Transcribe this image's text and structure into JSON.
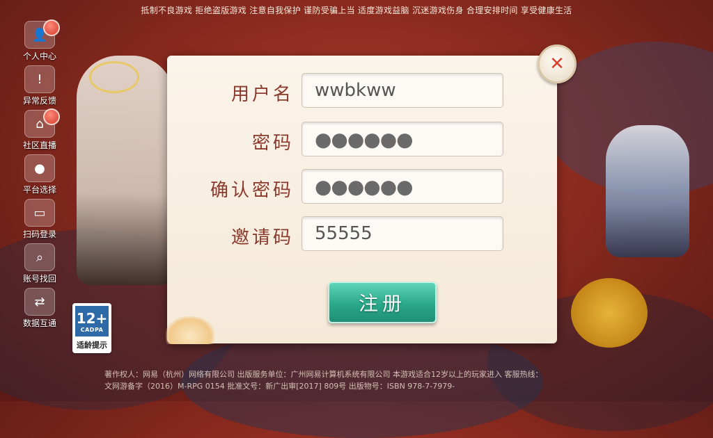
{
  "top_notice": "抵制不良游戏 拒绝盗版游戏 注意自我保护 谨防受骗上当 适度游戏益脑 沉迷游戏伤身 合理安排时间 享受健康生活",
  "sidebar": {
    "items": [
      {
        "label": "个人中心",
        "icon": "person-icon",
        "glyph": "👤",
        "badge": true
      },
      {
        "label": "异常反馈",
        "icon": "feedback-icon",
        "glyph": "!",
        "badge": false
      },
      {
        "label": "社区直播",
        "icon": "home-icon",
        "glyph": "⌂",
        "badge": true
      },
      {
        "label": "平台选择",
        "icon": "apple-icon",
        "glyph": "●",
        "badge": false
      },
      {
        "label": "扫码登录",
        "icon": "scan-icon",
        "glyph": "▭",
        "badge": false
      },
      {
        "label": "账号找回",
        "icon": "search-account-icon",
        "glyph": "⌕",
        "badge": false
      },
      {
        "label": "数据互通",
        "icon": "sync-icon",
        "glyph": "⇄",
        "badge": false
      }
    ]
  },
  "age_badge": {
    "rating": "12+",
    "org": "CADPA",
    "label": "适龄提示"
  },
  "form": {
    "username_label": "用户名",
    "username_value": "wwbkww",
    "password_label": "密码",
    "password_value": "●●●●●●",
    "confirm_label": "确认密码",
    "confirm_value": "●●●●●●",
    "invite_label": "邀请码",
    "invite_value": "55555",
    "register_label": "注册"
  },
  "close_glyph": "✕",
  "copyright_line1": "著作权人：网易（杭州）网络有限公司 出版服务单位：广州网易计算机系统有限公司 本游戏适合12岁以上的玩家进入 客服热线：",
  "copyright_line2": "文网游备字（2016）M-RPG 0154 批准文号：新广出审[2017] 809号 出版物号：ISBN 978-7-7979-"
}
